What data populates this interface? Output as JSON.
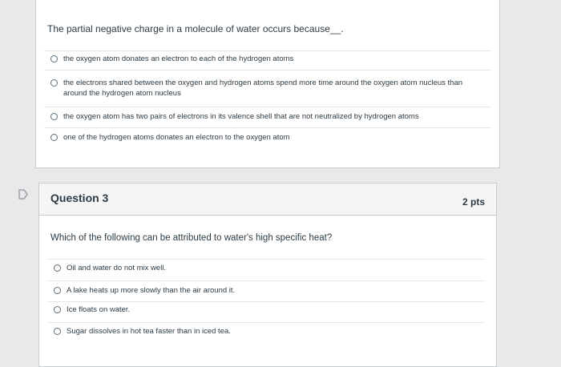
{
  "question2": {
    "prompt": "The partial negative charge in a molecule of water occurs because__.",
    "answers": [
      "the oxygen atom donates an electron to each of the hydrogen atoms",
      "the electrons shared between the oxygen and hydrogen atoms spend more time around the oxygen atom nucleus than around the hydrogen atom nucleus",
      "the oxygen atom has two pairs of electrons in its valence shell that are not neutralized by hydrogen atoms",
      "one of the hydrogen atoms donates an electron to the oxygen atom"
    ]
  },
  "question3": {
    "title": "Question 3",
    "points": "2 pts",
    "prompt": "Which of the following can be attributed to water's high specific heat?",
    "answers": [
      "Oil and water do not mix well.",
      "A lake heats up more slowly than the air around it.",
      "Ice floats on water.",
      "Sugar dissolves in hot tea faster than in iced tea."
    ]
  },
  "icons": {
    "flag": "flag-outline-icon"
  },
  "colors": {
    "page_background": "#e9e9e9",
    "card_background": "#ffffff",
    "header_background": "#f5f5f5",
    "text": "#2d3b45",
    "border": "#c7cdd1"
  }
}
